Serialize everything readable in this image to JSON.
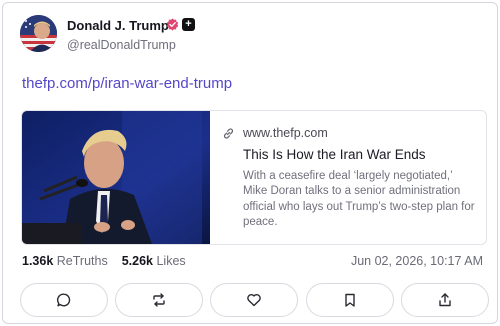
{
  "post": {
    "author_name": "Donald J. Trump",
    "author_handle": "@realDonaldTrump",
    "link_text": "thefp.com/p/iran-war-end-trump",
    "preview": {
      "domain": "www.thefp.com",
      "title": "This Is How the Iran War Ends",
      "description": "With a ceasefire deal ‘largely negotiated,’ Mike Doran talks to a senior administration official who lays out Trump’s two-step plan for peace."
    },
    "stats": {
      "retruths_count": "1.36k",
      "retruths_label": "ReTruths",
      "likes_count": "5.26k",
      "likes_label": "Likes"
    },
    "timestamp": "Jun 02, 2026, 10:17 AM"
  },
  "colors": {
    "link": "#5348c8",
    "verified_badge": "#e0466f",
    "border": "#d9d9e0"
  },
  "icons": [
    "verified-badge-icon",
    "plus-badge-icon",
    "link-icon",
    "comment-icon",
    "retruth-icon",
    "heart-icon",
    "bookmark-icon",
    "share-icon"
  ]
}
